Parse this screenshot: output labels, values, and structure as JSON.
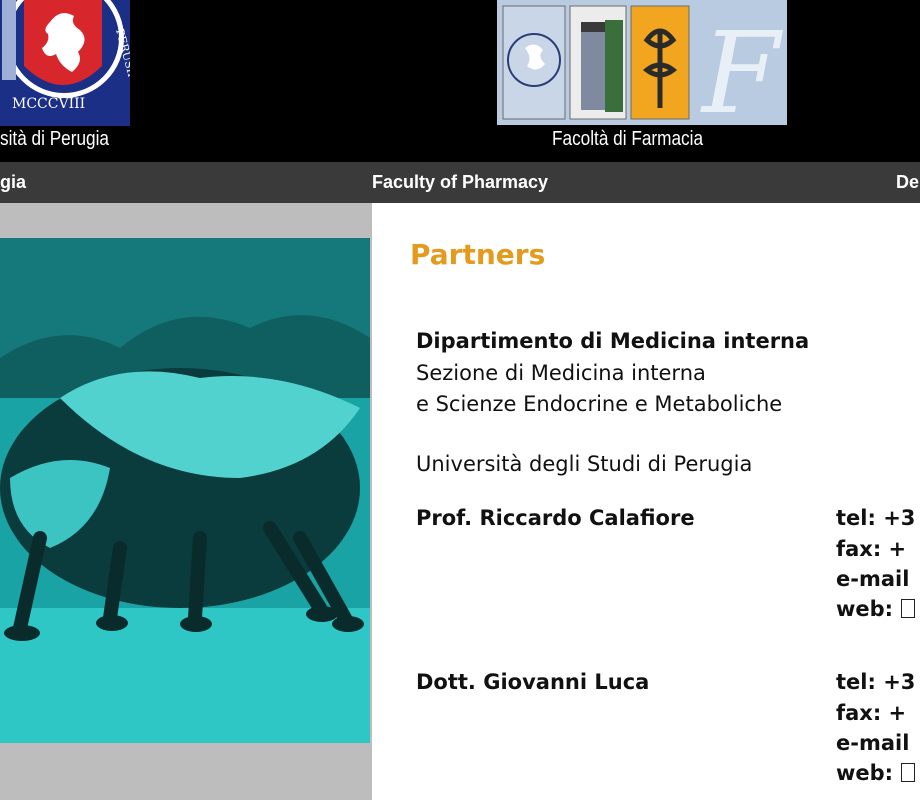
{
  "header": {
    "university_caption": "sità di Perugia",
    "university_seal_text": "PERUSII",
    "university_seal_year": "MCCCVIII",
    "faculty_caption": "Facoltà di Farmacia",
    "faculty_logo_letter": "F"
  },
  "nav": {
    "item1": "gia",
    "item2": "Faculty of Pharmacy",
    "item3": "De"
  },
  "main": {
    "title": "Partners",
    "department": {
      "name": "Dipartimento di Medicina interna",
      "section_line1": "Sezione di Medicina interna",
      "section_line2": "e Scienze Endocrine e Metaboliche",
      "university": "Università degli Studi di Perugia"
    },
    "contacts": [
      {
        "name": "Prof. Riccardo Calafiore",
        "tel": "tel: +3",
        "fax": "fax: +",
        "email": "e-mail",
        "web": "web:"
      },
      {
        "name": "Dott. Giovanni Luca",
        "tel": "tel: +3",
        "fax": "fax: +",
        "email": "e-mail",
        "web": "web:"
      }
    ]
  },
  "colors": {
    "header_bg": "#000000",
    "nav_bg": "#3a3a3a",
    "title": "#e39a1d",
    "sidebar_bg": "#bdbdbd",
    "photo_tint": "#1aa9aa"
  }
}
